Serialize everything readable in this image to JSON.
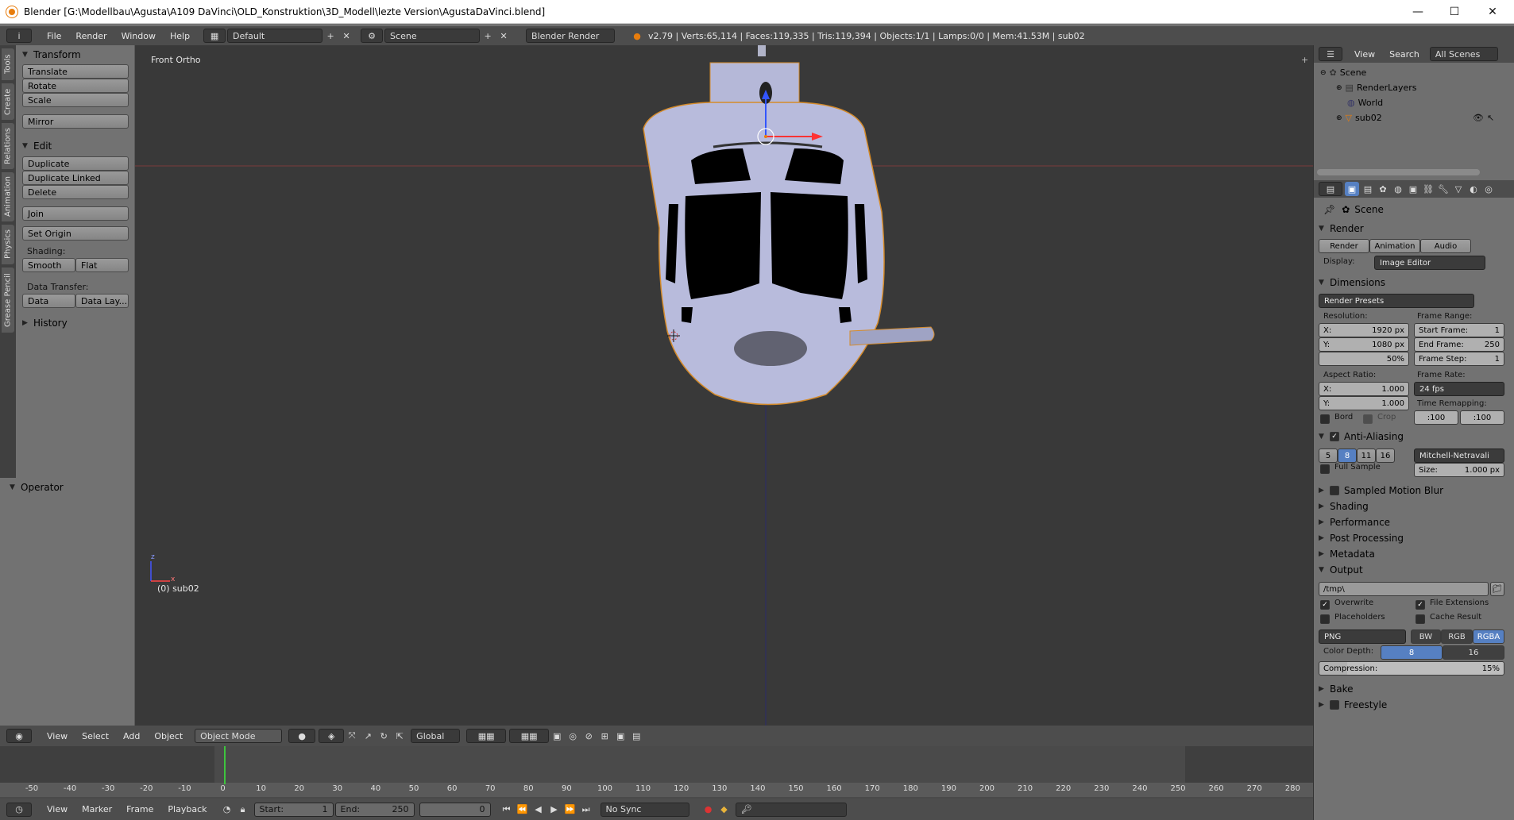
{
  "window": {
    "title": "Blender [G:\\Modellbau\\Agusta\\A109 DaVinci\\OLD_Konstruktion\\3D_Modell\\lezte Version\\AgustaDaVinci.blend]",
    "minimize": "—",
    "maximize": "☐",
    "close": "✕"
  },
  "menubar": {
    "info_icon": "i",
    "menus": [
      "File",
      "Render",
      "Window",
      "Help"
    ],
    "layout": "Default",
    "scene": "Scene",
    "engine": "Blender Render",
    "stats": "v2.79 | Verts:65,114 | Faces:119,335 | Tris:119,394 | Objects:1/1 | Lamps:0/0 | Mem:41.53M | sub02"
  },
  "toolshelf": {
    "tabs": [
      "Tools",
      "Create",
      "Relations",
      "Animation",
      "Physics",
      "Grease Pencil"
    ],
    "transform_header": "Transform",
    "translate": "Translate",
    "rotate": "Rotate",
    "scale": "Scale",
    "mirror": "Mirror",
    "edit_header": "Edit",
    "duplicate": "Duplicate",
    "duplicate_linked": "Duplicate Linked",
    "delete": "Delete",
    "join": "Join",
    "set_origin": "Set Origin",
    "shading_label": "Shading:",
    "smooth": "Smooth",
    "flat": "Flat",
    "data_transfer_label": "Data Transfer:",
    "data": "Data",
    "data_layout": "Data Lay...",
    "history_header": "History"
  },
  "operator": {
    "header": "Operator"
  },
  "viewport": {
    "view_name": "Front Ortho",
    "object_label": "(0) sub02",
    "axis_z": "z",
    "axis_x": "x"
  },
  "viewport_header": {
    "menus": [
      "View",
      "Select",
      "Add",
      "Object"
    ],
    "mode": "Object Mode",
    "orientation": "Global"
  },
  "timeline": {
    "ruler": [
      "-50",
      "-40",
      "-30",
      "-20",
      "-10",
      "0",
      "10",
      "20",
      "30",
      "40",
      "50",
      "60",
      "70",
      "80",
      "90",
      "100",
      "110",
      "120",
      "130",
      "140",
      "150",
      "160",
      "170",
      "180",
      "190",
      "200",
      "210",
      "220",
      "230",
      "240",
      "250",
      "260",
      "270",
      "280"
    ],
    "menus": [
      "View",
      "Marker",
      "Frame",
      "Playback"
    ],
    "start_label": "Start:",
    "start_value": "1",
    "end_label": "End:",
    "end_value": "250",
    "current_frame": "0",
    "sync": "No Sync"
  },
  "outliner": {
    "view": "View",
    "search": "Search",
    "filter": "All Scenes",
    "items": [
      "Scene",
      "RenderLayers",
      "World",
      "sub02"
    ]
  },
  "properties": {
    "context": "Scene",
    "render_header": "Render",
    "render_btn": "Render",
    "animation_btn": "Animation",
    "audio_btn": "Audio",
    "display_label": "Display:",
    "display_value": "Image Editor",
    "dimensions_header": "Dimensions",
    "render_presets": "Render Presets",
    "resolution_label": "Resolution:",
    "res_x_label": "X:",
    "res_x": "1920 px",
    "res_y_label": "Y:",
    "res_y": "1080 px",
    "res_pct": "50%",
    "frame_range_label": "Frame Range:",
    "start_frame_label": "Start Frame:",
    "start_frame": "1",
    "end_frame_label": "End Frame:",
    "end_frame": "250",
    "frame_step_label": "Frame Step:",
    "frame_step": "1",
    "aspect_label": "Aspect Ratio:",
    "asp_x_label": "X:",
    "asp_x": "1.000",
    "asp_y_label": "Y:",
    "asp_y": "1.000",
    "frame_rate_label": "Frame Rate:",
    "frame_rate": "24 fps",
    "time_remap_label": "Time Remapping:",
    "remap_old": ":100",
    "remap_new": ":100",
    "bord": "Bord",
    "crop": "Crop",
    "aa_header": "Anti-Aliasing",
    "aa_samples": [
      "5",
      "8",
      "11",
      "16"
    ],
    "aa_filter": "Mitchell-Netravali",
    "full_sample": "Full Sample",
    "size_label": "Size:",
    "size_value": "1.000 px",
    "smb_header": "Sampled Motion Blur",
    "shading_header": "Shading",
    "performance_header": "Performance",
    "post_header": "Post Processing",
    "metadata_header": "Metadata",
    "output_header": "Output",
    "output_path": "/tmp\\",
    "overwrite": "Overwrite",
    "file_ext": "File Extensions",
    "placeholders": "Placeholders",
    "cache_result": "Cache Result",
    "format": "PNG",
    "bw": "BW",
    "rgb": "RGB",
    "rgba": "RGBA",
    "color_depth_label": "Color Depth:",
    "depth_8": "8",
    "depth_16": "16",
    "compression_label": "Compression:",
    "compression": "15%",
    "bake_header": "Bake",
    "freestyle_header": "Freestyle"
  }
}
